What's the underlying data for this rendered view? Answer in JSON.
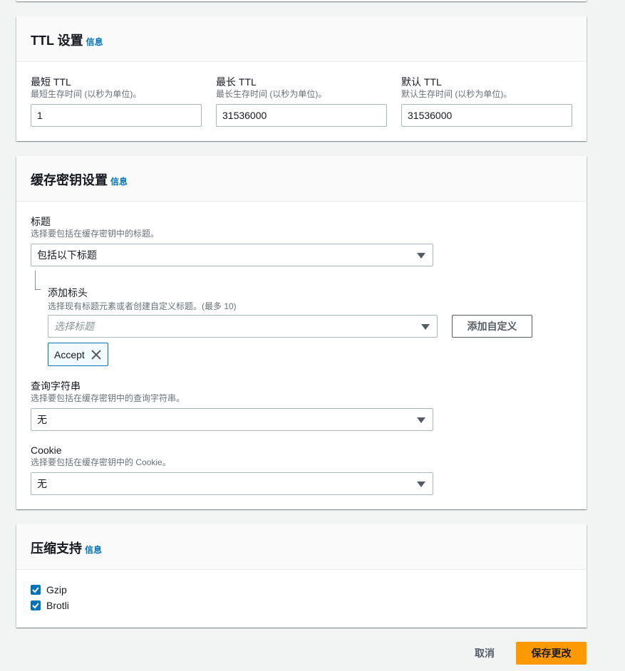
{
  "ttl": {
    "title": "TTL 设置",
    "info": "信息",
    "min": {
      "label": "最短 TTL",
      "desc": "最短生存时间 (以秒为单位)。",
      "value": "1"
    },
    "max": {
      "label": "最长 TTL",
      "desc": "最长生存时间 (以秒为单位)。",
      "value": "31536000"
    },
    "default": {
      "label": "默认 TTL",
      "desc": "默认生存时间 (以秒为单位)。",
      "value": "31536000"
    }
  },
  "cache_key": {
    "title": "缓存密钥设置",
    "info": "信息",
    "headers": {
      "label": "标题",
      "desc": "选择要包括在缓存密钥中的标题。",
      "selected": "包括以下标题"
    },
    "add_header": {
      "label": "添加标头",
      "desc": "选择现有标题元素或者创建自定义标题。(最多 10)",
      "placeholder": "选择标题",
      "add_custom_button": "添加自定义",
      "tokens": [
        "Accept"
      ]
    },
    "query_strings": {
      "label": "查询字符串",
      "desc": "选择要包括在缓存密钥中的查询字符串。",
      "selected": "无"
    },
    "cookies": {
      "label": "Cookie",
      "desc": "选择要包括在缓存密钥中的 Cookie。",
      "selected": "无"
    }
  },
  "compression": {
    "title": "压缩支持",
    "info": "信息",
    "options": [
      {
        "label": "Gzip",
        "checked": true
      },
      {
        "label": "Brotli",
        "checked": true
      }
    ]
  },
  "footer": {
    "cancel": "取消",
    "save": "保存更改"
  },
  "colors": {
    "primary_button": "#ff9900",
    "link": "#0073bb",
    "checkbox": "#0073bb"
  }
}
